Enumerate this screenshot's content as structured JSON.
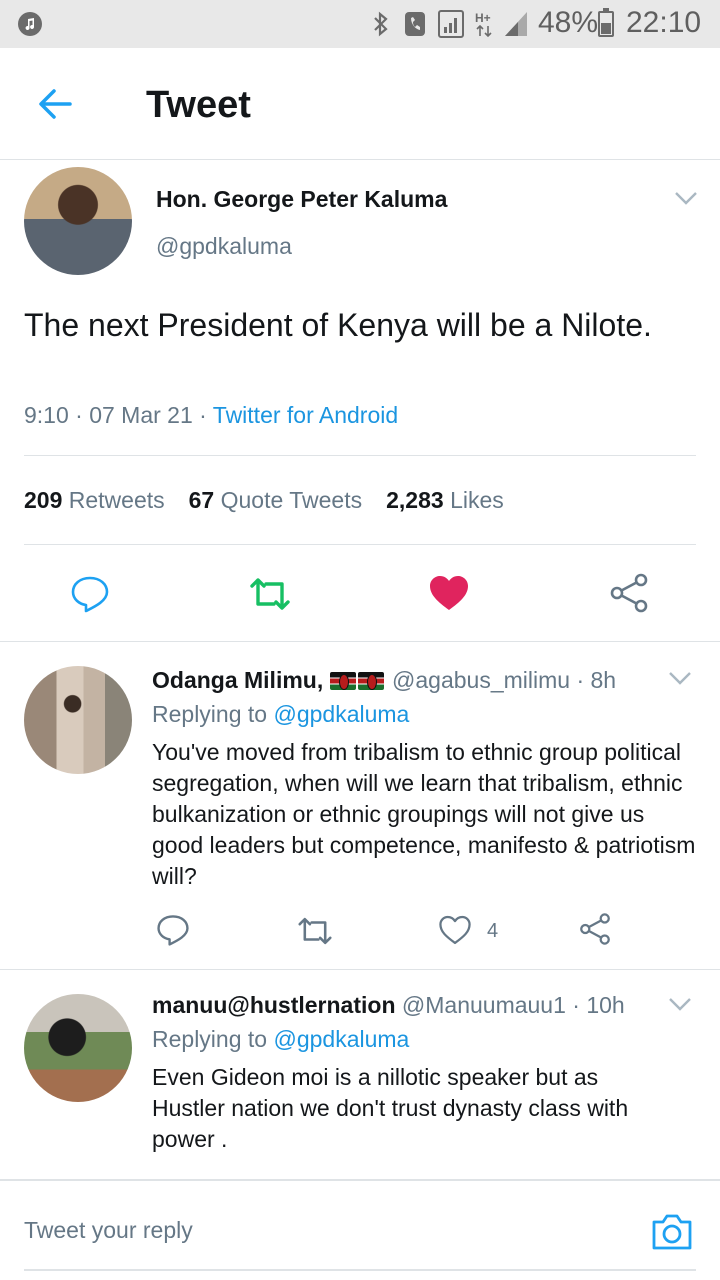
{
  "status_bar": {
    "battery": "48%",
    "time": "22:10",
    "icons": [
      "music-note-icon",
      "bluetooth-icon",
      "vibrate-icon",
      "signal-box-icon",
      "hplus-icon",
      "signal-icon",
      "battery-icon"
    ]
  },
  "header": {
    "title": "Tweet",
    "back_icon": "arrow-left-icon"
  },
  "tweet": {
    "author_name": "Hon. George Peter Kaluma",
    "author_handle": "@gpdkaluma",
    "text": "The next President of Kenya will be a Nilote.",
    "time_date": "9:10 · 07 Mar 21 · ",
    "source": "Twitter for Android",
    "retweets_count": "209",
    "retweets_label": "Retweets",
    "quotes_count": "67",
    "quotes_label": "Quote Tweets",
    "likes_count": "2,283",
    "likes_label": "Likes",
    "liked": true,
    "retweeted": true,
    "colors": {
      "accent": "#1da1f2",
      "retweet": "#17bf63",
      "like": "#e0245e"
    }
  },
  "replies": [
    {
      "name": "Odanga Milimu,",
      "flags": 2,
      "handle_time": "@agabus_milimu · 8h",
      "replying_label": "Replying to ",
      "replying_to": "@gpdkaluma",
      "text": "You've moved from tribalism to ethnic group political segregation, when will we learn that tribalism, ethnic bulkanization or ethnic groupings will not give us good leaders but competence, manifesto & patriotism will?",
      "like_count": "4"
    },
    {
      "name": "manuu@hustlernation",
      "handle_time": "@Manuumauu1 · 10h",
      "replying_label": "Replying to ",
      "replying_to": "@gpdkaluma",
      "text": "Even Gideon moi is a nillotic speaker but as Hustler nation we don't trust dynasty class with power ."
    }
  ],
  "composer": {
    "placeholder": "Tweet your reply",
    "camera_icon": "camera-icon"
  }
}
